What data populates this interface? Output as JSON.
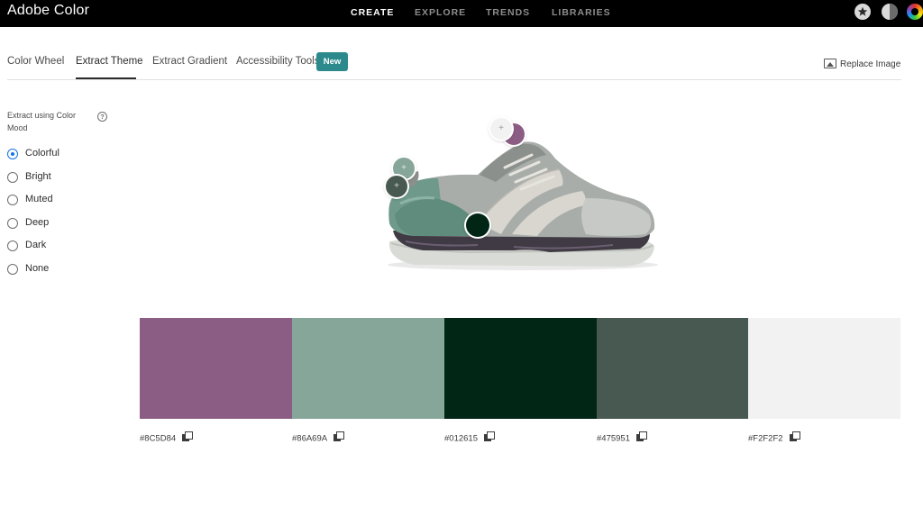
{
  "app": {
    "title": "Adobe Color"
  },
  "topnav": [
    {
      "label": "CREATE",
      "active": true
    },
    {
      "label": "EXPLORE",
      "active": false
    },
    {
      "label": "TRENDS",
      "active": false
    },
    {
      "label": "LIBRARIES",
      "active": false
    }
  ],
  "top_icons": [
    "star-icon",
    "contrast-icon",
    "color-wheel-icon"
  ],
  "tabs": [
    {
      "label": "Color Wheel",
      "active": false
    },
    {
      "label": "Extract Theme",
      "active": true
    },
    {
      "label": "Extract Gradient",
      "active": false
    },
    {
      "label": "Accessibility Tools",
      "active": false
    }
  ],
  "new_badge": "New",
  "replace_image": {
    "label": "Replace Image",
    "icon": "image-icon"
  },
  "mood": {
    "title": "Extract using Color Mood",
    "help_icon": "?",
    "options": [
      {
        "label": "Colorful",
        "checked": true
      },
      {
        "label": "Bright",
        "checked": false
      },
      {
        "label": "Muted",
        "checked": false
      },
      {
        "label": "Deep",
        "checked": false
      },
      {
        "label": "Dark",
        "checked": false
      },
      {
        "label": "None",
        "checked": false
      }
    ]
  },
  "pickers": {
    "plus": "+"
  },
  "swatches": [
    {
      "hex": "#8C5D84"
    },
    {
      "hex": "#86A69A"
    },
    {
      "hex": "#012615"
    },
    {
      "hex": "#475951"
    },
    {
      "hex": "#F2F2F2"
    }
  ]
}
